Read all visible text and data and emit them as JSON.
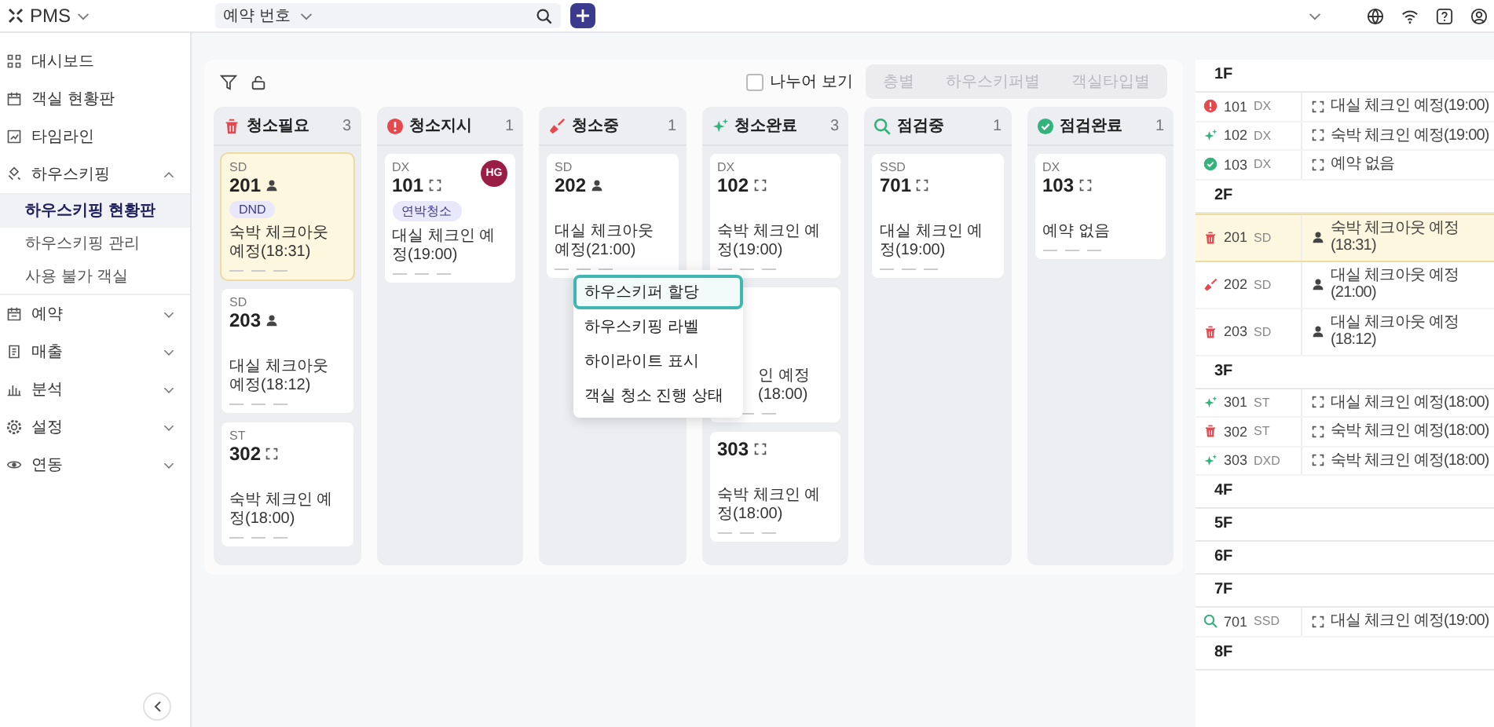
{
  "app": {
    "title": "PMS"
  },
  "search": {
    "scope": "예약 번호"
  },
  "sidebar": {
    "items": [
      {
        "label": "대시보드"
      },
      {
        "label": "객실 현황판"
      },
      {
        "label": "타임라인"
      },
      {
        "label": "하우스키핑",
        "expanded": true,
        "children": [
          {
            "label": "하우스키핑 현황판",
            "selected": true
          },
          {
            "label": "하우스키핑 관리",
            "selected": false
          },
          {
            "label": "사용 불가 객실",
            "selected": false
          }
        ]
      },
      {
        "label": "예약",
        "expanded": false
      },
      {
        "label": "매출",
        "expanded": false
      },
      {
        "label": "분석",
        "expanded": false
      },
      {
        "label": "설정",
        "expanded": false
      },
      {
        "label": "연동",
        "expanded": false
      }
    ]
  },
  "toolbar": {
    "split_view": {
      "label": "나누어 보기",
      "checked": false
    },
    "view_modes": [
      {
        "label": "층별",
        "selected": false,
        "disabled": true
      },
      {
        "label": "하우스키퍼별",
        "selected": false,
        "disabled": true
      },
      {
        "label": "객실타입별",
        "selected": false,
        "disabled": true
      }
    ]
  },
  "columns": [
    {
      "kind": "need",
      "title": "청소필요",
      "count": "3",
      "cards": [
        {
          "type": "SD",
          "number": "201",
          "occupied": true,
          "tag": "DND",
          "note": "숙박 체크아웃 예정(18:31)",
          "highlighted": true
        },
        {
          "type": "SD",
          "number": "203",
          "occupied": true,
          "note": "대실 체크아웃 예정(18:12)",
          "highlighted": false
        },
        {
          "type": "ST",
          "number": "302",
          "occupied": false,
          "note": "숙박 체크인 예정(18:00)",
          "highlighted": false
        }
      ]
    },
    {
      "kind": "ordered",
      "title": "청소지시",
      "count": "1",
      "cards": [
        {
          "type": "DX",
          "number": "101",
          "occupied": false,
          "tag": "연박청소",
          "avatar": "HG",
          "note": "대실 체크인 예정(19:00)",
          "highlighted": false
        }
      ]
    },
    {
      "kind": "cleaning",
      "title": "청소중",
      "count": "1",
      "cards": [
        {
          "type": "SD",
          "number": "202",
          "occupied": true,
          "note": "대실 체크아웃 예정(21:00)",
          "highlighted": false
        }
      ]
    },
    {
      "kind": "cleaned",
      "title": "청소완료",
      "count": "3",
      "cards": [
        {
          "type": "DX",
          "number": "102",
          "occupied": false,
          "note": "숙박 체크인 예정(19:00)",
          "highlighted": false
        },
        {
          "note": "인 예정(18:00)",
          "highlighted": false
        },
        {
          "number": "303",
          "occupied": false,
          "note": "숙박 체크인 예정(18:00)",
          "highlighted": false
        }
      ]
    },
    {
      "kind": "inspecting",
      "title": "점검중",
      "count": "1",
      "cards": [
        {
          "type": "SSD",
          "number": "701",
          "occupied": false,
          "note": "대실 체크인 예정(19:00)",
          "highlighted": false
        }
      ]
    },
    {
      "kind": "inspected",
      "title": "점검완료",
      "count": "1",
      "cards": [
        {
          "type": "DX",
          "number": "103",
          "occupied": false,
          "note": "예약 없음",
          "highlighted": false
        }
      ]
    }
  ],
  "context_menu": {
    "items": [
      {
        "label": "하우스키퍼 할당",
        "selected": true
      },
      {
        "label": "하우스키핑 라벨",
        "selected": false
      },
      {
        "label": "하이라이트 표시",
        "selected": false
      },
      {
        "label": "객실 청소 진행 상태",
        "selected": false
      }
    ]
  },
  "floors": [
    {
      "label": "1F",
      "rooms": [
        {
          "kind": "ordered",
          "number": "101",
          "type": "DX",
          "occupied": false,
          "note": "대실 체크인 예정(19:00)",
          "highlighted": false
        },
        {
          "kind": "cleaned",
          "number": "102",
          "type": "DX",
          "occupied": false,
          "note": "숙박 체크인 예정(19:00)",
          "highlighted": false
        },
        {
          "kind": "inspected",
          "number": "103",
          "type": "DX",
          "occupied": false,
          "note": "예약 없음",
          "highlighted": false
        }
      ]
    },
    {
      "label": "2F",
      "rooms": [
        {
          "kind": "need",
          "number": "201",
          "type": "SD",
          "occupied": true,
          "note": "숙박 체크아웃 예정(18:31)",
          "highlighted": true
        },
        {
          "kind": "cleaning",
          "number": "202",
          "type": "SD",
          "occupied": true,
          "note": "대실 체크아웃 예정(21:00)",
          "highlighted": false
        },
        {
          "kind": "need",
          "number": "203",
          "type": "SD",
          "occupied": true,
          "note": "대실 체크아웃 예정(18:12)",
          "highlighted": false
        }
      ]
    },
    {
      "label": "3F",
      "rooms": [
        {
          "kind": "cleaned",
          "number": "301",
          "type": "ST",
          "occupied": false,
          "note": "대실 체크인 예정(18:00)",
          "highlighted": false
        },
        {
          "kind": "need",
          "number": "302",
          "type": "ST",
          "occupied": false,
          "note": "숙박 체크인 예정(18:00)",
          "highlighted": false
        },
        {
          "kind": "cleaned",
          "number": "303",
          "type": "DXD",
          "occupied": false,
          "note": "숙박 체크인 예정(18:00)",
          "highlighted": false
        }
      ]
    },
    {
      "label": "4F"
    },
    {
      "label": "5F"
    },
    {
      "label": "6F"
    },
    {
      "label": "7F",
      "rooms": [
        {
          "kind": "inspecting",
          "number": "701",
          "type": "SSD",
          "occupied": false,
          "note": "대실 체크인 예정(19:00)",
          "highlighted": false
        }
      ]
    },
    {
      "label": "8F"
    }
  ]
}
